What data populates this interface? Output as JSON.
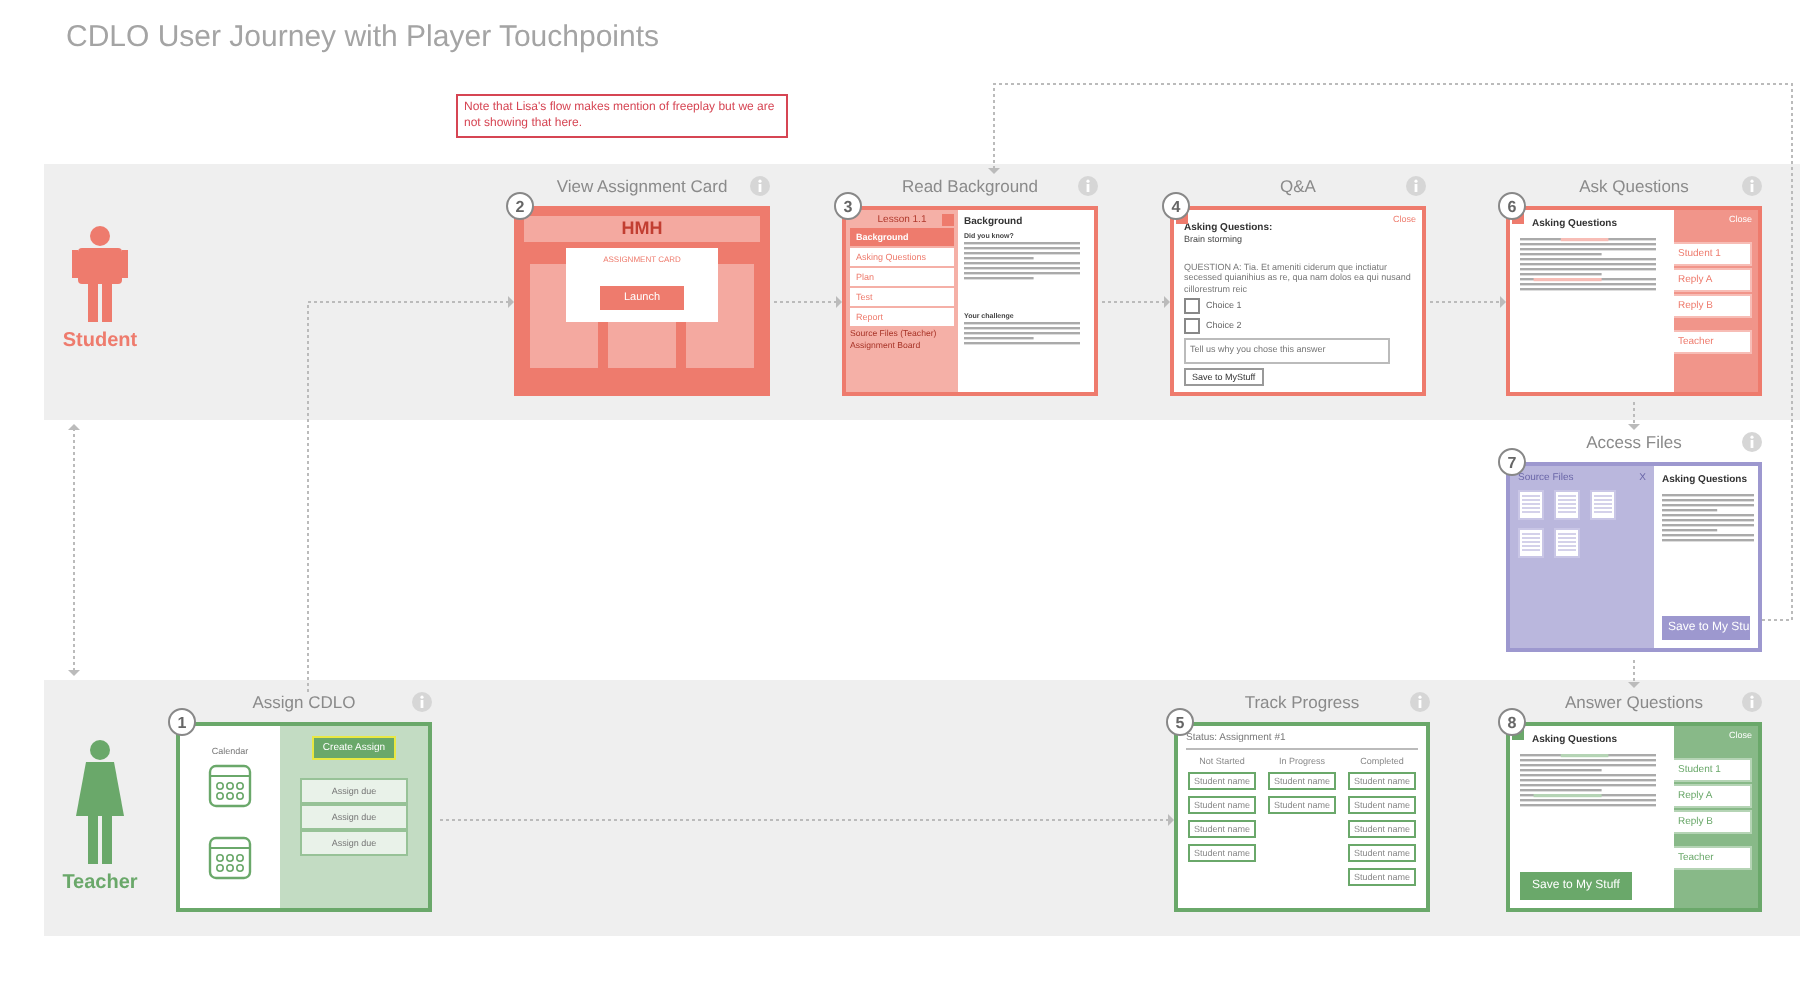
{
  "title": "CDLO User Journey with Player Touchpoints",
  "note": "Note that Lisa's flow makes mention of freeplay but we are not showing that here.",
  "lanes": [
    {
      "label": "Student",
      "color": "#ee7b6d",
      "steps": [
        {
          "number": "2",
          "title": "View Assignment Card",
          "kind": "card",
          "brand": "HMH",
          "label": "ASSIGNMENT CARD",
          "button": "Launch"
        },
        {
          "number": "3",
          "title": "Read Background",
          "kind": "lesson",
          "lesson": "Lesson 1.1",
          "menu": [
            {
              "label": "Background",
              "selected": true
            },
            {
              "label": "Asking Questions",
              "selected": false
            },
            {
              "label": "Plan",
              "selected": false
            },
            {
              "label": "Test",
              "selected": false
            },
            {
              "label": "Report",
              "selected": false
            }
          ],
          "links": [
            "Source Files (Teacher)",
            "Assignment Board"
          ],
          "heading": "Background",
          "sections": [
            "Did you know?",
            "Your challenge"
          ]
        },
        {
          "number": "4",
          "title": "Q&A",
          "kind": "qa",
          "close": "Close",
          "heading": "Asking Questions:",
          "subheading": "Brain storming",
          "question": "QUESTION A: Tia. Et ameniti ciderum que inctiatur secessed quianihius as re, qua nam dolos ea qui nusand cillorestrum reic",
          "choices": [
            {
              "label": "Choice 1",
              "checked": false
            },
            {
              "label": "Choice 2",
              "checked": false
            }
          ],
          "placeholder": "Tell us why you chose this answer",
          "button": "Save to MyStuff"
        },
        {
          "number": "6",
          "title": "Ask Questions",
          "kind": "discussion",
          "close": "Close",
          "heading": "Asking Questions",
          "replies": [
            "Student 1",
            "Reply A",
            "Reply B",
            "Teacher"
          ]
        },
        {
          "number": "7",
          "title": "Access Files",
          "kind": "files",
          "panel": "Source Files",
          "close": "X",
          "heading": "Asking Questions",
          "button": "Save to My Stu"
        }
      ]
    },
    {
      "label": "Teacher",
      "color": "#6aa86a",
      "steps": [
        {
          "number": "1",
          "title": "Assign CDLO",
          "kind": "assign",
          "calendar": "Calendar",
          "button": "Create Assign",
          "items": [
            "Assign due",
            "Assign due",
            "Assign due"
          ]
        },
        {
          "number": "5",
          "title": "Track Progress",
          "kind": "progress",
          "status": "Status: Assignment #1",
          "columns": [
            {
              "heading": "Not Started",
              "names": [
                "Student name",
                "Student name",
                "Student name",
                "Student name"
              ]
            },
            {
              "heading": "In Progress",
              "names": [
                "Student name",
                "Student name"
              ]
            },
            {
              "heading": "Completed",
              "names": [
                "Student name",
                "Student name",
                "Student name",
                "Student name",
                "Student name"
              ]
            }
          ]
        },
        {
          "number": "8",
          "title": "Answer Questions",
          "kind": "discussion",
          "close": "Close",
          "heading": "Asking Questions",
          "replies": [
            "Student 1",
            "Reply A",
            "Reply B",
            "Teacher"
          ],
          "button": "Save to My Stuff"
        }
      ]
    }
  ]
}
